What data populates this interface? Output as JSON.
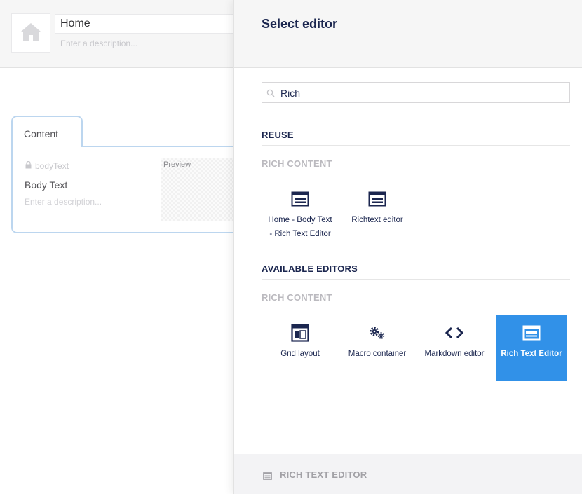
{
  "background": {
    "node_name": "Home",
    "node_description_placeholder": "Enter a description...",
    "tab_label": "Content",
    "property": {
      "alias": "bodyText",
      "label": "Body Text",
      "description_placeholder": "Enter a description...",
      "preview_label": "Preview"
    }
  },
  "panel": {
    "title": "Select editor",
    "search_value": "Rich",
    "reuse": {
      "title": "REUSE",
      "group": "RICH CONTENT",
      "items": [
        {
          "label": "Home - Body Text - Rich Text Editor",
          "icon": "rte-icon"
        },
        {
          "label": "Richtext editor",
          "icon": "rte-icon"
        }
      ]
    },
    "available": {
      "title": "AVAILABLE EDITORS",
      "group": "RICH CONTENT",
      "items": [
        {
          "label": "Grid layout",
          "icon": "grid-layout-icon"
        },
        {
          "label": "Macro container",
          "icon": "settings-gears-icon"
        },
        {
          "label": "Markdown editor",
          "icon": "code-icon"
        },
        {
          "label": "Rich Text Editor",
          "icon": "rte-icon",
          "selected": true
        }
      ]
    },
    "footer_label": "RICH TEXT EDITOR"
  },
  "colors": {
    "accent": "#3191e8",
    "text": "#1b264f",
    "muted": "#bbbabf"
  }
}
